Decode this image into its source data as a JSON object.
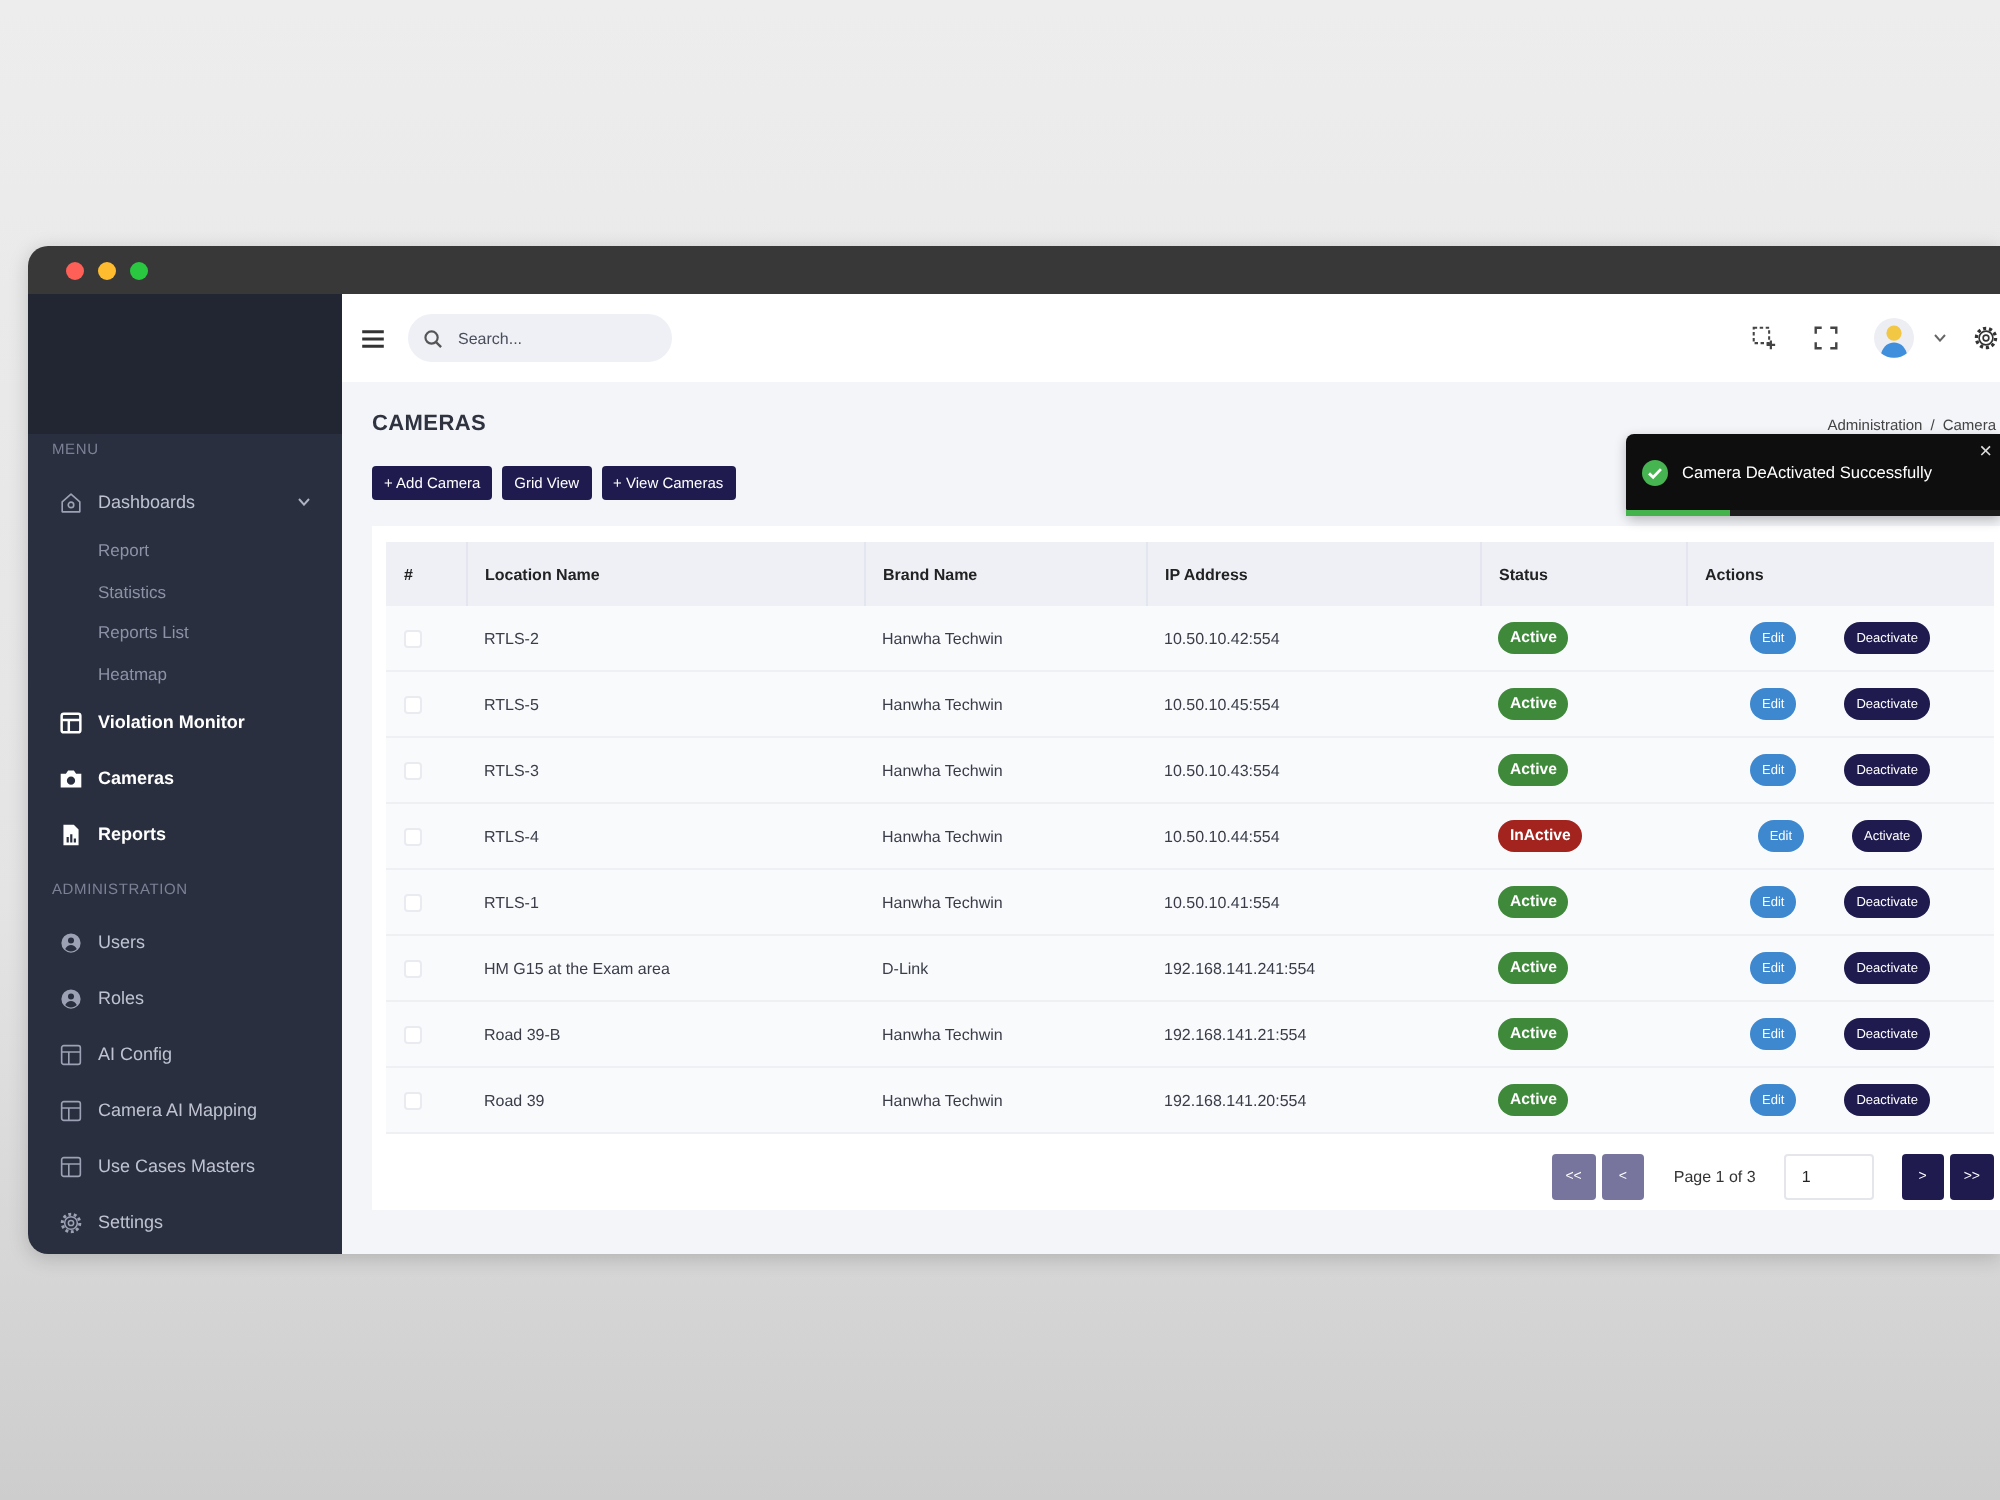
{
  "sidebar": {
    "sections": [
      {
        "label": "MENU",
        "items": [
          {
            "kind": "group",
            "label": "Dashboards",
            "highlighted": false,
            "expanded": true,
            "children": [
              {
                "label": "Report"
              },
              {
                "label": "Statistics"
              },
              {
                "label": "Reports List"
              },
              {
                "label": "Heatmap"
              }
            ]
          },
          {
            "kind": "link",
            "label": "Violation Monitor",
            "highlighted": true
          },
          {
            "kind": "link",
            "label": "Cameras",
            "highlighted": true
          },
          {
            "kind": "link",
            "label": "Reports",
            "highlighted": true
          }
        ]
      },
      {
        "label": "ADMINISTRATION",
        "items": [
          {
            "kind": "link",
            "label": "Users",
            "highlighted": false
          },
          {
            "kind": "link",
            "label": "Roles",
            "highlighted": false
          },
          {
            "kind": "link",
            "label": "AI Config",
            "highlighted": false
          },
          {
            "kind": "link",
            "label": "Camera AI Mapping",
            "highlighted": false
          },
          {
            "kind": "link",
            "label": "Use Cases Masters",
            "highlighted": false
          },
          {
            "kind": "link",
            "label": "Settings",
            "highlighted": false
          }
        ]
      }
    ]
  },
  "topbar": {
    "search": {
      "placeholder": "Search..."
    }
  },
  "page": {
    "title": "CAMERAS",
    "breadcrumb": {
      "items": [
        "Administration",
        "Camera"
      ],
      "separator": "/"
    },
    "buttons": [
      "+ Add Camera",
      "Grid View",
      "+ View Cameras"
    ]
  },
  "table": {
    "columns": [
      "#",
      "Location Name",
      "Brand Name",
      "IP Address",
      "Status",
      "Actions"
    ],
    "rows": [
      {
        "checked": false,
        "location": "RTLS-2",
        "brand": "Hanwha Techwin",
        "ip": "10.50.10.42:554",
        "status": {
          "label": "Active",
          "kind": "active"
        },
        "actions": [
          {
            "label": "Edit",
            "kind": "edit"
          },
          {
            "label": "Deactivate",
            "kind": "deactivate"
          }
        ]
      },
      {
        "checked": false,
        "location": "RTLS-5",
        "brand": "Hanwha Techwin",
        "ip": "10.50.10.45:554",
        "status": {
          "label": "Active",
          "kind": "active"
        },
        "actions": [
          {
            "label": "Edit",
            "kind": "edit"
          },
          {
            "label": "Deactivate",
            "kind": "deactivate"
          }
        ]
      },
      {
        "checked": false,
        "location": "RTLS-3",
        "brand": "Hanwha Techwin",
        "ip": "10.50.10.43:554",
        "status": {
          "label": "Active",
          "kind": "active"
        },
        "actions": [
          {
            "label": "Edit",
            "kind": "edit"
          },
          {
            "label": "Deactivate",
            "kind": "deactivate"
          }
        ]
      },
      {
        "checked": false,
        "location": "RTLS-4",
        "brand": "Hanwha Techwin",
        "ip": "10.50.10.44:554",
        "status": {
          "label": "InActive",
          "kind": "inactive"
        },
        "actions": [
          {
            "label": "Edit",
            "kind": "edit"
          },
          {
            "label": "Activate",
            "kind": "activate"
          }
        ]
      },
      {
        "checked": false,
        "location": "RTLS-1",
        "brand": "Hanwha Techwin",
        "ip": "10.50.10.41:554",
        "status": {
          "label": "Active",
          "kind": "active"
        },
        "actions": [
          {
            "label": "Edit",
            "kind": "edit"
          },
          {
            "label": "Deactivate",
            "kind": "deactivate"
          }
        ]
      },
      {
        "checked": false,
        "location": "HM G15 at the Exam area",
        "brand": "D-Link",
        "ip": "192.168.141.241:554",
        "status": {
          "label": "Active",
          "kind": "active"
        },
        "actions": [
          {
            "label": "Edit",
            "kind": "edit"
          },
          {
            "label": "Deactivate",
            "kind": "deactivate"
          }
        ]
      },
      {
        "checked": false,
        "location": "Road 39-B",
        "brand": "Hanwha Techwin",
        "ip": "192.168.141.21:554",
        "status": {
          "label": "Active",
          "kind": "active"
        },
        "actions": [
          {
            "label": "Edit",
            "kind": "edit"
          },
          {
            "label": "Deactivate",
            "kind": "deactivate"
          }
        ]
      },
      {
        "checked": false,
        "location": "Road 39",
        "brand": "Hanwha Techwin",
        "ip": "192.168.141.20:554",
        "status": {
          "label": "Active",
          "kind": "active"
        },
        "actions": [
          {
            "label": "Edit",
            "kind": "edit"
          },
          {
            "label": "Deactivate",
            "kind": "deactivate"
          }
        ]
      }
    ]
  },
  "pagination": {
    "prev_buttons": [
      {
        "label": "<<",
        "disabled": true
      },
      {
        "label": "<",
        "disabled": true
      }
    ],
    "info": "Page 1 of 3",
    "page_input": {
      "value": "1"
    },
    "next_buttons": [
      {
        "label": ">",
        "disabled": false
      },
      {
        "label": ">>",
        "disabled": false
      }
    ]
  },
  "toast": {
    "message": "Camera DeActivated Successfully",
    "close": "×",
    "level": 0.28
  }
}
